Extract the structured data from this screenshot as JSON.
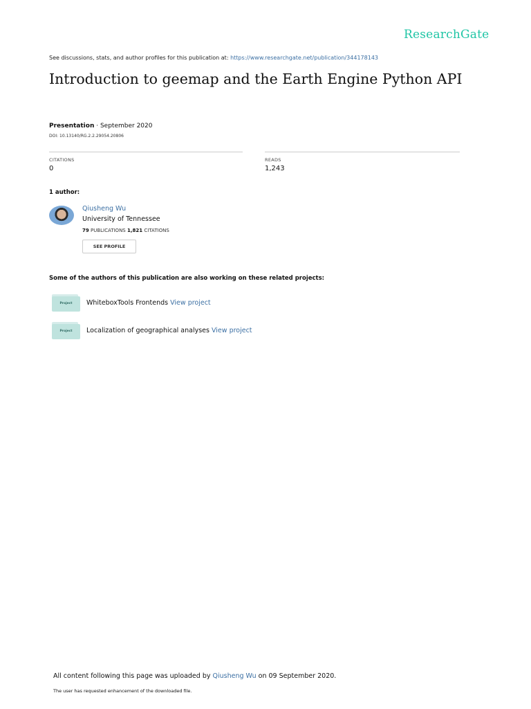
{
  "brand": "ResearchGate",
  "header": {
    "prefix": "See discussions, stats, and author profiles for this publication at: ",
    "url": "https://www.researchgate.net/publication/344178143"
  },
  "title": "Introduction to geemap and the Earth Engine Python API",
  "type": "Presentation",
  "date": " · September 2020",
  "doi": "DOI: 10.13140/RG.2.2.29054.20806",
  "stats": {
    "citations_label": "CITATIONS",
    "citations": "0",
    "reads_label": "READS",
    "reads": "1,243"
  },
  "authors_heading": "1 author:",
  "author": {
    "name": "Qiusheng Wu",
    "institution": "University of Tennessee",
    "publications": "79",
    "publications_label": " PUBLICATIONS ",
    "citations": "1,821",
    "citations_label": " CITATIONS",
    "button": "SEE PROFILE"
  },
  "projects_heading": "Some of the authors of this publication are also working on these related projects:",
  "projects": [
    {
      "badge": "Project",
      "name": "WhiteboxTools Frontends ",
      "link": "View project"
    },
    {
      "badge": "Project",
      "name": "Localization of geographical analyses ",
      "link": "View project"
    }
  ],
  "footer": {
    "prefix": "All content following this page was uploaded by ",
    "user": "Qiusheng Wu",
    "suffix": " on 09 September 2020.",
    "note": "The user has requested enhancement of the downloaded file."
  }
}
